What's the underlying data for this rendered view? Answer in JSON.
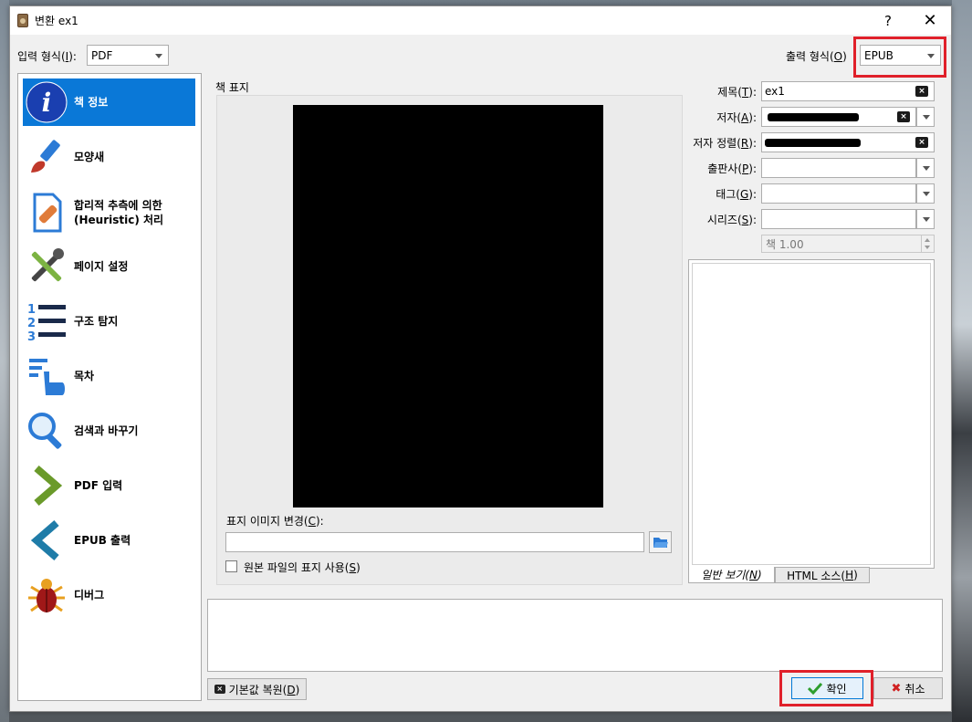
{
  "window": {
    "title": "변환 ex1",
    "help_label": "?",
    "close_label": "✕"
  },
  "input_format": {
    "label_prefix": "입력 형식(",
    "label_key": "I",
    "label_suffix": "):",
    "value": "PDF"
  },
  "output_format": {
    "label_prefix": "출력 형식(",
    "label_key": "O",
    "label_suffix": ")",
    "value": "EPUB"
  },
  "sidebar": {
    "items": [
      {
        "label": "책 정보",
        "icon": "info-icon",
        "active": true
      },
      {
        "label": "모양새",
        "icon": "paintbrush-icon"
      },
      {
        "label": "합리적 추측에 의한 (Heuristic) 처리",
        "icon": "document-bandage-icon"
      },
      {
        "label": "페이지 설정",
        "icon": "tools-icon"
      },
      {
        "label": "구조 탐지",
        "icon": "numbered-list-icon"
      },
      {
        "label": "목차",
        "icon": "toc-hand-icon"
      },
      {
        "label": "검색과 바꾸기",
        "icon": "magnifier-icon"
      },
      {
        "label": "PDF 입력",
        "icon": "chevron-right-icon"
      },
      {
        "label": "EPUB 출력",
        "icon": "chevron-left-icon"
      },
      {
        "label": "디버그",
        "icon": "bug-icon"
      }
    ]
  },
  "cover": {
    "heading": "책 표지",
    "change_label_prefix": "표지 이미지 변경(",
    "change_label_key": "C",
    "change_label_suffix": "):",
    "path_value": "",
    "use_source_label_prefix": "원본 파일의 표지 사용(",
    "use_source_label_key": "S",
    "use_source_label_suffix": ")",
    "use_source_checked": false
  },
  "metadata": {
    "title": {
      "label_prefix": "제목(",
      "key": "T",
      "label_suffix": "):",
      "value": "ex1"
    },
    "author": {
      "label_prefix": "저자(",
      "key": "A",
      "label_suffix": "):",
      "value": ""
    },
    "author_sort": {
      "label_prefix": "저자 정렬(",
      "key": "R",
      "label_suffix": "):",
      "value": ""
    },
    "publisher": {
      "label_prefix": "출판사(",
      "key": "P",
      "label_suffix": "):",
      "value": ""
    },
    "tags": {
      "label_prefix": "태그(",
      "key": "G",
      "label_suffix": "):",
      "value": ""
    },
    "series": {
      "label_prefix": "시리즈(",
      "key": "S",
      "label_suffix": "):",
      "value": ""
    },
    "series_index": "책 1.00"
  },
  "comment_tabs": [
    {
      "label_prefix": "일반 보기(",
      "key": "N",
      "label_suffix": ")",
      "active": true
    },
    {
      "label_prefix": "HTML 소스(",
      "key": "H",
      "label_suffix": ")",
      "active": false
    }
  ],
  "buttons": {
    "restore_prefix": "기본값 복원(",
    "restore_key": "D",
    "restore_suffix": ")",
    "ok": "확인",
    "cancel": "취소"
  },
  "colors": {
    "accent": "#0a78d7",
    "highlight": "#e0202a",
    "ok_check": "#2e9e2e",
    "cancel_x": "#d02020"
  }
}
